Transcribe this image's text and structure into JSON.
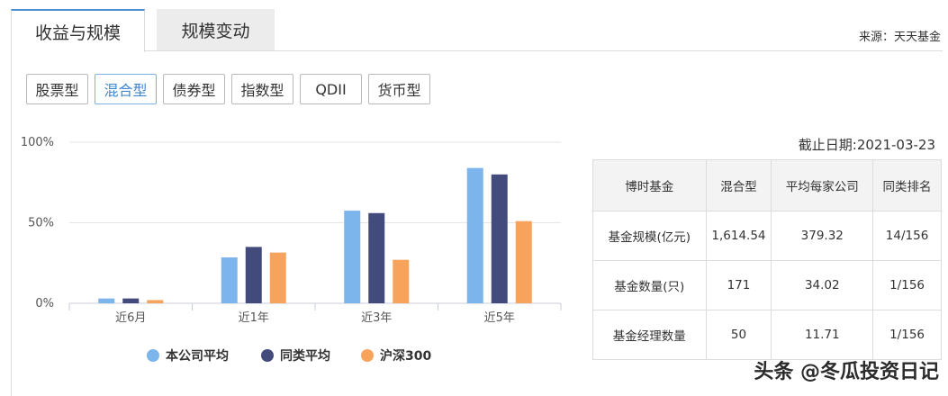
{
  "main_tabs": [
    {
      "label": "收益与规模",
      "active": true
    },
    {
      "label": "规模变动",
      "active": false
    }
  ],
  "source": "来源：天天基金",
  "fund_types": [
    {
      "label": "股票型",
      "active": false
    },
    {
      "label": "混合型",
      "active": true
    },
    {
      "label": "债券型",
      "active": false
    },
    {
      "label": "指数型",
      "active": false
    },
    {
      "label": "QDII",
      "active": false
    },
    {
      "label": "货币型",
      "active": false
    }
  ],
  "chart_data": {
    "type": "bar",
    "categories": [
      "近6月",
      "近1年",
      "近3年",
      "近5年"
    ],
    "series": [
      {
        "name": "本公司平均",
        "color": "#7cb5ec",
        "values": [
          3,
          28.5,
          57.5,
          84
        ]
      },
      {
        "name": "同类平均",
        "color": "#434b7d",
        "values": [
          3,
          35,
          56,
          80
        ]
      },
      {
        "name": "沪深300",
        "color": "#f7a35c",
        "values": [
          2,
          31.5,
          27,
          51
        ]
      }
    ],
    "yticks": [
      "0%",
      "50%",
      "100%"
    ],
    "ylim": [
      0,
      100
    ],
    "grid": true,
    "legend": "bottom"
  },
  "as_of": "截止日期:2021-03-23",
  "stats_table": {
    "headers": [
      "博时基金",
      "混合型",
      "平均每家公司",
      "同类排名"
    ],
    "rows": [
      [
        "基金规模(亿元)",
        "1,614.54",
        "379.32",
        "14/156"
      ],
      [
        "基金数量(只)",
        "171",
        "34.02",
        "1/156"
      ],
      [
        "基金经理数量",
        "50",
        "11.71",
        "1/156"
      ]
    ]
  },
  "watermark": "头条 @冬瓜投资日记"
}
